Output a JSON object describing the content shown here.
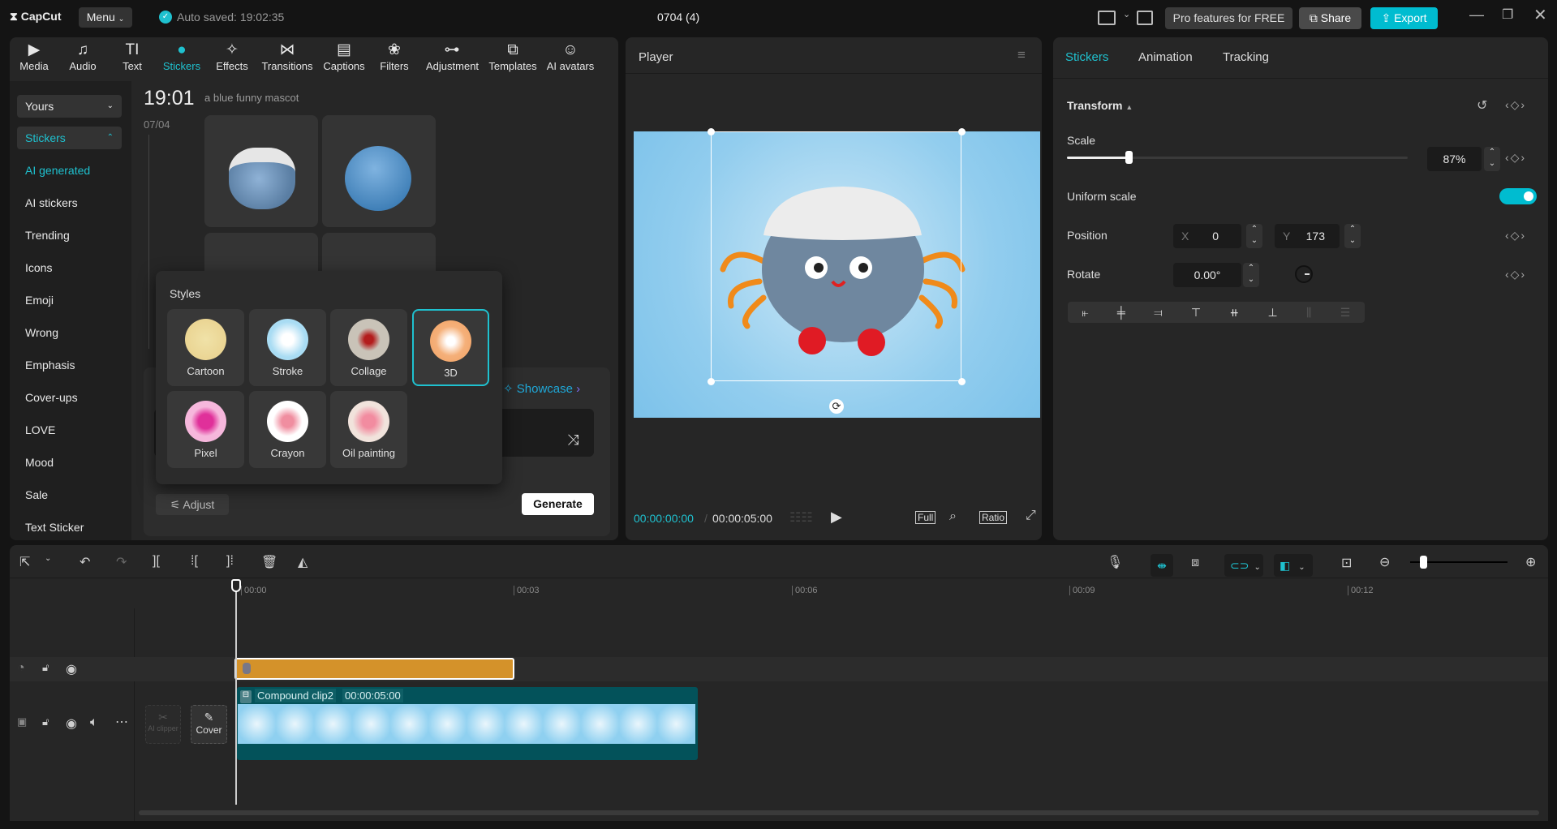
{
  "titlebar": {
    "app": "CapCut",
    "menu": "Menu",
    "autosave": "Auto saved: 19:02:35",
    "project": "0704 (4)",
    "pro": "Pro features for FREE",
    "share": "Share",
    "export": "Export"
  },
  "tools": [
    {
      "label": "Media",
      "icon": "▶"
    },
    {
      "label": "Audio",
      "icon": "♫"
    },
    {
      "label": "Text",
      "icon": "TI"
    },
    {
      "label": "Stickers",
      "icon": "●"
    },
    {
      "label": "Effects",
      "icon": "✧"
    },
    {
      "label": "Transitions",
      "icon": "⋈"
    },
    {
      "label": "Captions",
      "icon": "▤"
    },
    {
      "label": "Filters",
      "icon": "❀"
    },
    {
      "label": "Adjustment",
      "icon": "⊶"
    },
    {
      "label": "Templates",
      "icon": "⧉"
    },
    {
      "label": "AI avatars",
      "icon": "☺"
    }
  ],
  "sidebar": {
    "yours": "Yours",
    "stickers": "Stickers",
    "items": [
      "AI generated",
      "AI stickers",
      "Trending",
      "Icons",
      "Emoji",
      "Wrong",
      "Emphasis",
      "Cover-ups",
      "LOVE",
      "Mood",
      "Sale",
      "Text Sticker"
    ]
  },
  "content": {
    "time": "19:01",
    "prompt": "a blue funny mascot",
    "date": "07/04",
    "showcase": "Showcase",
    "adjust": "Adjust",
    "generate": "Generate"
  },
  "styles": {
    "title": "Styles",
    "items": [
      "Cartoon",
      "Stroke",
      "Collage",
      "3D",
      "Pixel",
      "Crayon",
      "Oil painting"
    ],
    "selected": "3D"
  },
  "player": {
    "title": "Player",
    "current": "00:00:00:00",
    "duration": "00:00:05:00",
    "full": "Full",
    "ratio": "Ratio"
  },
  "inspector": {
    "tabs": [
      "Stickers",
      "Animation",
      "Tracking"
    ],
    "section": "Transform",
    "scale_label": "Scale",
    "scale_value": "87%",
    "scale_fraction": 0.18,
    "uniform": "Uniform scale",
    "uniform_on": true,
    "position": "Position",
    "x_label": "X",
    "x": "0",
    "y_label": "Y",
    "y": "173",
    "rotate": "Rotate",
    "rotate_value": "0.00°"
  },
  "timeline": {
    "ticks": [
      "00:00",
      "00:03",
      "00:06",
      "00:09",
      "00:12"
    ],
    "clip_name": "Compound clip2",
    "clip_duration": "00:00:05:00",
    "ai_clipper": "AI clipper",
    "cover": "Cover"
  },
  "colors": {
    "accent": "#1fc1cf",
    "sticker_clip": "#d4922a",
    "main_clip": "#03525a"
  }
}
